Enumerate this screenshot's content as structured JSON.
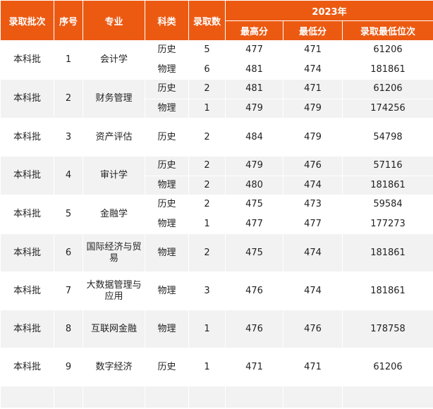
{
  "header": {
    "batch": "录取批次",
    "seq": "序号",
    "major": "专业",
    "subject": "科类",
    "admitted": "录取数",
    "year": "2023年",
    "max_score": "最高分",
    "min_score": "最低分",
    "min_rank": "录取最低位次"
  },
  "rows": [
    {
      "batch": "本科批",
      "seq": "1",
      "major": "会计学",
      "sub": [
        {
          "subject": "历史",
          "admitted": "5",
          "max": "477",
          "min": "471",
          "rank": "61206"
        },
        {
          "subject": "物理",
          "admitted": "6",
          "max": "481",
          "min": "474",
          "rank": "181861"
        }
      ]
    },
    {
      "batch": "本科批",
      "seq": "2",
      "major": "财务管理",
      "sub": [
        {
          "subject": "历史",
          "admitted": "2",
          "max": "481",
          "min": "471",
          "rank": "61206"
        },
        {
          "subject": "物理",
          "admitted": "1",
          "max": "479",
          "min": "479",
          "rank": "174256"
        }
      ]
    },
    {
      "batch": "本科批",
      "seq": "3",
      "major": "资产评估",
      "sub": [
        {
          "subject": "历史",
          "admitted": "2",
          "max": "484",
          "min": "479",
          "rank": "54798"
        }
      ]
    },
    {
      "batch": "本科批",
      "seq": "4",
      "major": "审计学",
      "sub": [
        {
          "subject": "历史",
          "admitted": "2",
          "max": "479",
          "min": "476",
          "rank": "57116"
        },
        {
          "subject": "物理",
          "admitted": "2",
          "max": "480",
          "min": "474",
          "rank": "181861"
        }
      ]
    },
    {
      "batch": "本科批",
      "seq": "5",
      "major": "金融学",
      "sub": [
        {
          "subject": "历史",
          "admitted": "2",
          "max": "475",
          "min": "473",
          "rank": "59584"
        },
        {
          "subject": "物理",
          "admitted": "1",
          "max": "477",
          "min": "477",
          "rank": "177273"
        }
      ]
    },
    {
      "batch": "本科批",
      "seq": "6",
      "major": "国际经济与贸易",
      "sub": [
        {
          "subject": "物理",
          "admitted": "2",
          "max": "475",
          "min": "474",
          "rank": "181861"
        }
      ]
    },
    {
      "batch": "本科批",
      "seq": "7",
      "major": "大数据管理与应用",
      "sub": [
        {
          "subject": "物理",
          "admitted": "3",
          "max": "476",
          "min": "474",
          "rank": "181861"
        }
      ]
    },
    {
      "batch": "本科批",
      "seq": "8",
      "major": "互联网金融",
      "sub": [
        {
          "subject": "物理",
          "admitted": "1",
          "max": "476",
          "min": "476",
          "rank": "178758"
        }
      ]
    },
    {
      "batch": "本科批",
      "seq": "9",
      "major": "数字经济",
      "sub": [
        {
          "subject": "历史",
          "admitted": "1",
          "max": "471",
          "min": "471",
          "rank": "61206"
        }
      ]
    }
  ]
}
